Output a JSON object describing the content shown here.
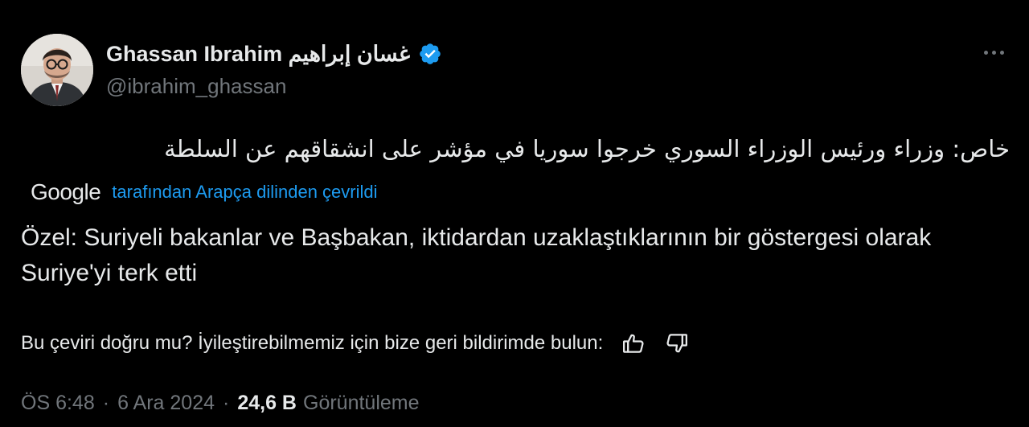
{
  "author": {
    "display_name": "Ghassan Ibrahim غسان إبراهيم",
    "handle": "@ibrahim_ghassan",
    "verified": true,
    "verified_icon": "verified-badge-icon",
    "verified_color": "#1d9bf0"
  },
  "more_icon": "more-options-icon",
  "tweet": {
    "original_text": "خاص: وزراء ورئيس الوزراء السوري خرجوا سوريا في مؤشر على انشقاقهم عن السلطة",
    "translation_provider": "Google",
    "translated_by_text": "tarafından Arapça dilinden çevrildi",
    "translated_text": "Özel: Suriyeli bakanlar ve Başbakan, iktidardan uzaklaştıklarının bir göstergesi olarak Suriye'yi terk etti"
  },
  "feedback": {
    "prompt": "Bu çeviri doğru mu? İyileştirebilmemiz için bize geri bildirimde bulun:",
    "like_icon": "thumbs-up-icon",
    "dislike_icon": "thumbs-down-icon"
  },
  "meta": {
    "time": "ÖS 6:48",
    "separator": "·",
    "date": "6 Ara 2024",
    "views_count": "24,6 B",
    "views_label": "Görüntüleme"
  },
  "colors": {
    "background": "#000000",
    "primary_text": "#e7e9ea",
    "secondary_text": "#71767b",
    "link": "#1d9bf0"
  }
}
